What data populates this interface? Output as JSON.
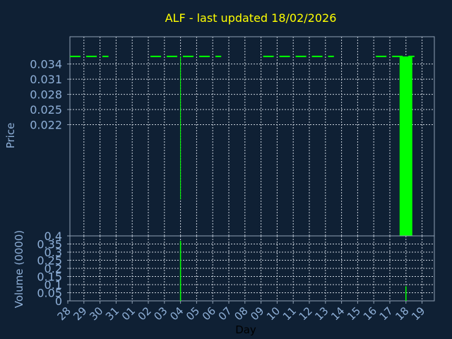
{
  "colors": {
    "background": "#0f2034",
    "frame": "#8fa0b4",
    "grid": "#c8d0da",
    "title": "#ffff00",
    "axis_text": "#8fb0d8",
    "price": "#00ff00",
    "volume": "#00ff00"
  },
  "chart_data": [
    {
      "type": "candlestick",
      "title": "ALF - last updated 18/02/2026",
      "xlabel": "",
      "ylabel": "Price",
      "ylim": [
        0.0,
        0.0394
      ],
      "yticks": [
        "0.034",
        "0.031",
        "0.028",
        "0.025",
        "0.022"
      ],
      "ytick_values": [
        0.034,
        0.031,
        0.028,
        0.025,
        0.022
      ],
      "x_days": [
        "28",
        "29",
        "30",
        "31",
        "01",
        "02",
        "03",
        "04",
        "05",
        "06",
        "07",
        "08",
        "09",
        "10",
        "11",
        "12",
        "13",
        "14",
        "15",
        "16",
        "17",
        "18",
        "19"
      ],
      "reference_line": {
        "value": 0.0355,
        "style": "dashed",
        "segments": [
          [
            0,
            2
          ],
          [
            5,
            9
          ],
          [
            12,
            16
          ],
          [
            19,
            21
          ]
        ]
      },
      "candles": [
        {
          "day": "04",
          "open": 0.0355,
          "high": 0.0355,
          "low": 0.0072,
          "close": 0.0355
        },
        {
          "day": "18",
          "open": 0.0355,
          "high": 0.0355,
          "low": 0.0,
          "close": 0.0
        }
      ],
      "grid": true
    },
    {
      "type": "bar",
      "xlabel": "Day",
      "ylabel": "Volume (0000)",
      "ylim": [
        0,
        0.4
      ],
      "yticks": [
        "0.4",
        "0.35",
        "0.3",
        "0.25",
        "0.2",
        "0.15",
        "0.1",
        "0.05",
        "0"
      ],
      "ytick_values": [
        0.4,
        0.35,
        0.3,
        0.25,
        0.2,
        0.15,
        0.1,
        0.05,
        0
      ],
      "categories": [
        "04",
        "18"
      ],
      "values": [
        0.37,
        0.09
      ],
      "grid": true
    }
  ]
}
